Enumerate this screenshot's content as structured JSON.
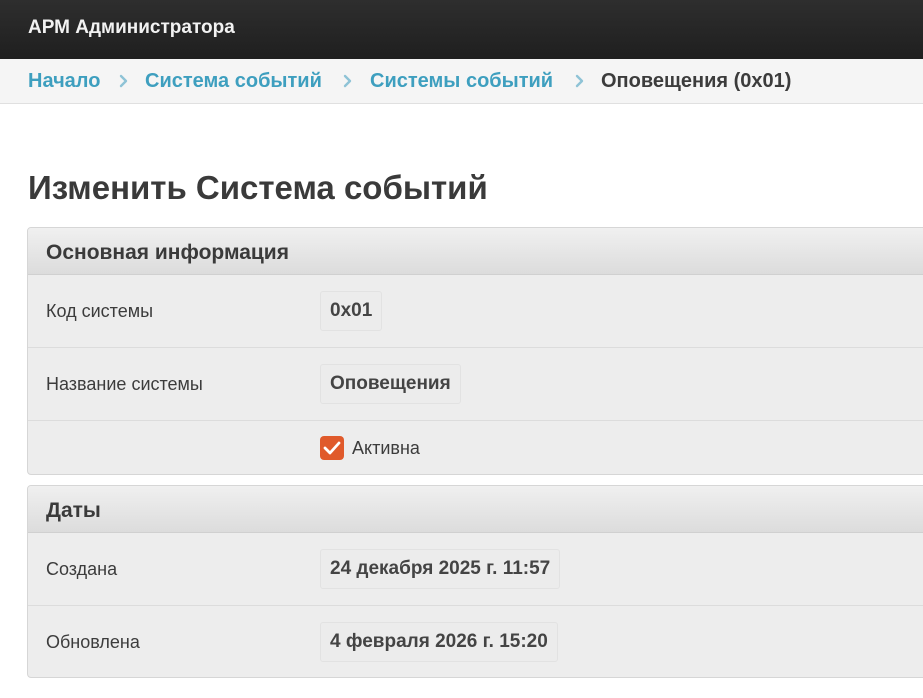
{
  "header": {
    "app_title": "АРМ Администратора"
  },
  "breadcrumb": {
    "items": [
      {
        "label": "Начало",
        "link": true
      },
      {
        "label": "Система событий",
        "link": true
      },
      {
        "label": "Системы событий",
        "link": true
      },
      {
        "label": "Оповещения (0x01)",
        "link": false
      }
    ],
    "separator_icon": "chevron-right-icon"
  },
  "page": {
    "title": "Изменить Система событий"
  },
  "main_info": {
    "heading": "Основная информация",
    "system_code_label": "Код системы",
    "system_code_value": "0x01",
    "system_name_label": "Название системы",
    "system_name_value": "Оповещения",
    "active_label": "Активна",
    "active_checked": true
  },
  "dates": {
    "heading": "Даты",
    "created_label": "Создана",
    "created_value": "24 декабря 2025 г. 11:57",
    "updated_label": "Обновлена",
    "updated_value": "4 февраля 2026 г. 15:20"
  },
  "colors": {
    "link": "#3e9fbf",
    "checkbox_accent": "#e05a2b",
    "topbar": "#262626"
  }
}
